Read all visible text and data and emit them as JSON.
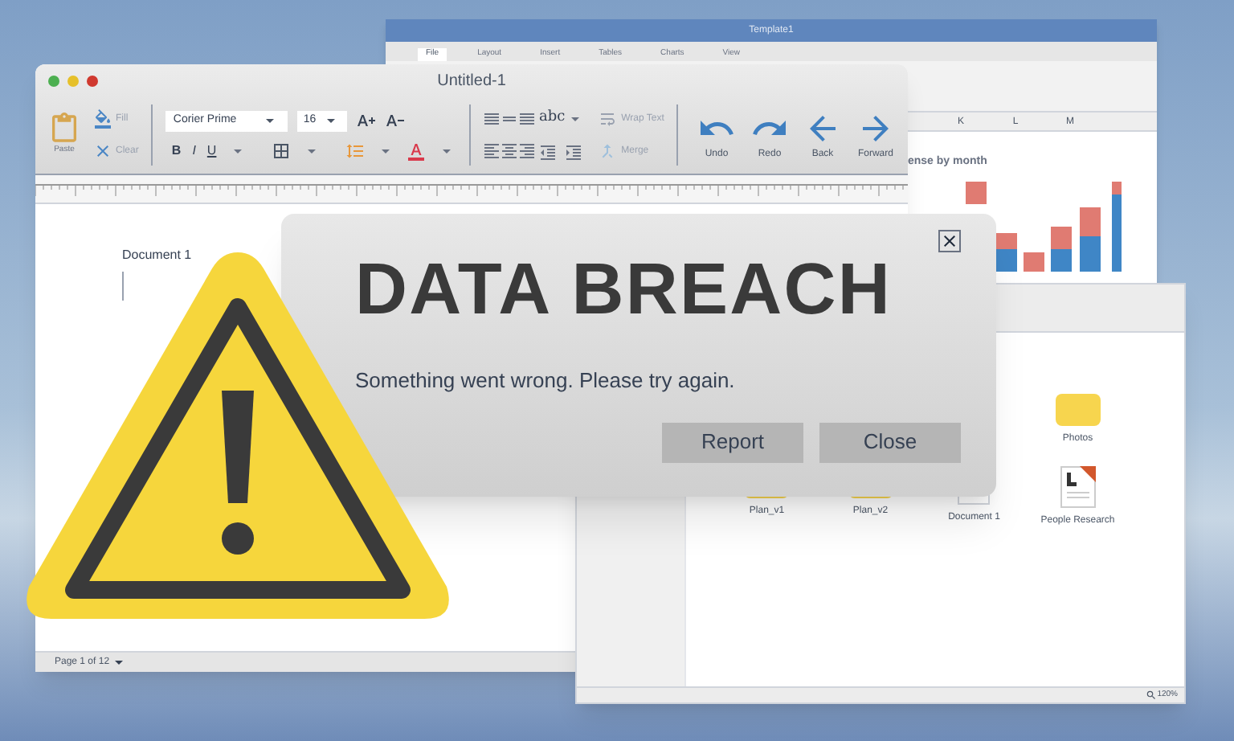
{
  "spreadsheet_window": {
    "title": "Template1",
    "tabs": [
      {
        "label": "File",
        "selected": true
      },
      {
        "label": "Layout",
        "selected": false
      },
      {
        "label": "Insert",
        "selected": false
      },
      {
        "label": "Tables",
        "selected": false
      },
      {
        "label": "Charts",
        "selected": false
      },
      {
        "label": "View",
        "selected": false
      }
    ],
    "columns": [
      "K",
      "L",
      "M"
    ],
    "chart_title": "ense by month"
  },
  "editor_window": {
    "title": "Untitled-1",
    "toolbar": {
      "paste": "Paste",
      "fill": "Fill",
      "clear": "Clear",
      "font": "Corier Prime",
      "size": "16",
      "bold": "B",
      "italic": "I",
      "underline": "U",
      "spelling": "abc",
      "wrap_text": "Wrap Text",
      "merge": "Merge",
      "actions": [
        {
          "label": "Undo",
          "kind": "undo"
        },
        {
          "label": "Redo",
          "kind": "redo"
        },
        {
          "label": "Back",
          "kind": "back"
        },
        {
          "label": "Forward",
          "kind": "forward"
        }
      ]
    },
    "document_title": "Document 1",
    "page_indicator": "Page 1 of 12"
  },
  "file_window": {
    "items": [
      {
        "name": "Photos",
        "kind": "folder"
      },
      {
        "name": "Plan_v1",
        "kind": "folder"
      },
      {
        "name": "Plan_v2",
        "kind": "folder"
      },
      {
        "name": "Document 1",
        "kind": "document"
      },
      {
        "name": "People Research",
        "kind": "letter_document"
      }
    ],
    "zoom": "120%"
  },
  "alert": {
    "title": "DATA BREACH",
    "message": "Something went wrong. Please try again.",
    "buttons": [
      "Report",
      "Close"
    ]
  }
}
